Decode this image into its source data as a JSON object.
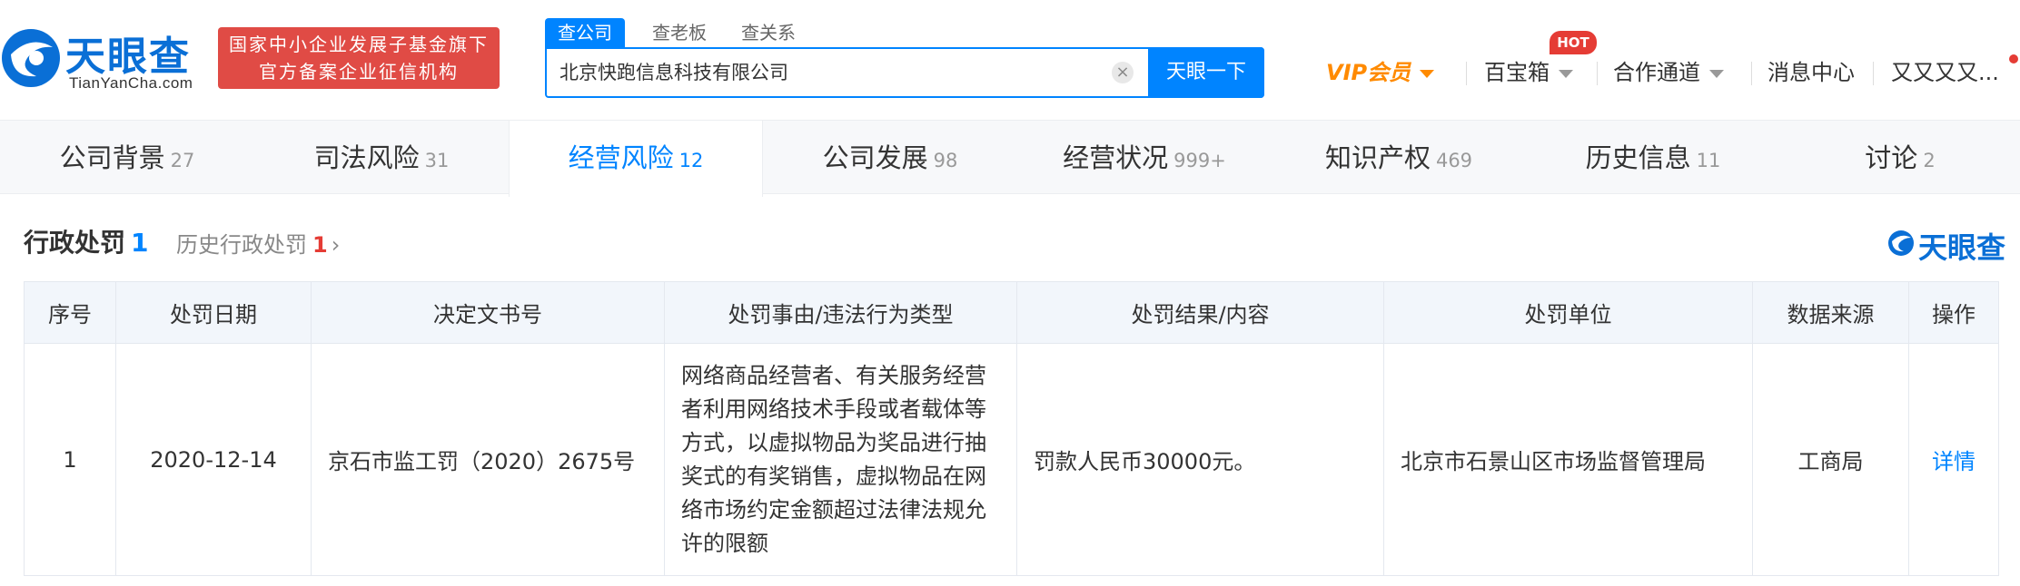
{
  "header": {
    "logo_title": "天眼查",
    "logo_domain": "TianYanCha.com",
    "gov_badge_line1": "国家中小企业发展子基金旗下",
    "gov_badge_line2": "官方备案企业征信机构",
    "search_tabs": [
      "查公司",
      "查老板",
      "查关系"
    ],
    "search_value": "北京快跑信息科技有限公司",
    "search_clear": "×",
    "search_button": "天眼一下",
    "nav": {
      "vip": "VIP会员",
      "treasure": "百宝箱",
      "hot_badge": "HOT",
      "cooperation": "合作通道",
      "messages": "消息中心",
      "user": "又又又又..."
    }
  },
  "tabs": [
    {
      "label": "公司背景",
      "count": "27"
    },
    {
      "label": "司法风险",
      "count": "31"
    },
    {
      "label": "经营风险",
      "count": "12"
    },
    {
      "label": "公司发展",
      "count": "98"
    },
    {
      "label": "经营状况",
      "count": "999+"
    },
    {
      "label": "知识产权",
      "count": "469"
    },
    {
      "label": "历史信息",
      "count": "11"
    },
    {
      "label": "讨论",
      "count": "2"
    }
  ],
  "section": {
    "title": "行政处罚",
    "count": "1",
    "history_label": "历史行政处罚",
    "history_count": "1",
    "history_arrow": "›",
    "brand": "天眼查"
  },
  "table": {
    "headers": [
      "序号",
      "处罚日期",
      "决定文书号",
      "处罚事由/违法行为类型",
      "处罚结果/内容",
      "处罚单位",
      "数据来源",
      "操作"
    ],
    "rows": [
      {
        "index": "1",
        "date": "2020-12-14",
        "doc_no": "京石市监工罚（2020）2675号",
        "reason": "网络商品经营者、有关服务经营者利用网络技术手段或者载体等方式，以虚拟物品为奖品进行抽奖式的有奖销售，虚拟物品在网络市场约定金额超过法律法规允许的限额",
        "result": "罚款人民币30000元。",
        "unit": "北京市石景山区市场监督管理局",
        "source": "工商局",
        "action": "详情"
      }
    ]
  },
  "colors": {
    "primary": "#0084ff",
    "brand": "#0a6fd6",
    "badge_red": "#e04b45",
    "vip_orange": "#ff8a00"
  }
}
